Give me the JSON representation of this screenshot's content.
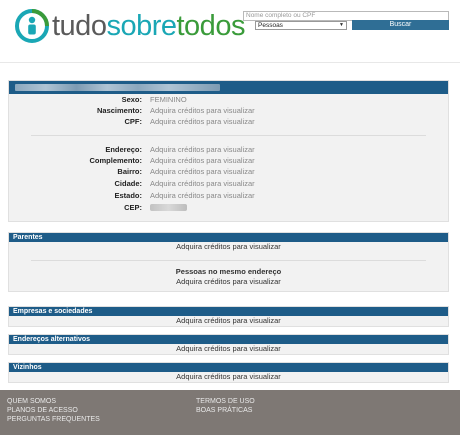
{
  "brand": {
    "name_parts": [
      "tudo",
      "sobre",
      "todos"
    ],
    "colors": {
      "gray": "#5a5a5a",
      "teal": "#1aa7b5",
      "green": "#3a9b3a",
      "header_blue": "#1e5c88",
      "button_blue": "#2f6e95"
    }
  },
  "search": {
    "placeholder": "Nome completo ou CPF",
    "select_value": "Pessoas",
    "button_label": "Buscar"
  },
  "person": {
    "fields_top": [
      {
        "label": "Sexo:",
        "value": "FEMININO"
      },
      {
        "label": "Nascimento:",
        "value": "Adquira créditos para visualizar"
      },
      {
        "label": "CPF:",
        "value": "Adquira créditos para visualizar"
      }
    ],
    "fields_address": [
      {
        "label": "Endereço:",
        "value": "Adquira créditos para visualizar"
      },
      {
        "label": "Complemento:",
        "value": "Adquira créditos para visualizar"
      },
      {
        "label": "Bairro:",
        "value": "Adquira créditos para visualizar"
      },
      {
        "label": "Cidade:",
        "value": "Adquira créditos para visualizar"
      },
      {
        "label": "Estado:",
        "value": "Adquira créditos para visualizar"
      }
    ],
    "cep_label": "CEP:"
  },
  "sections": {
    "parentes": {
      "title": "Parentes",
      "line1": "Adquira créditos para visualizar",
      "sub_title": "Pessoas no mesmo endereço",
      "line2": "Adquira créditos para visualizar"
    },
    "empresas": {
      "title": "Empresas e sociedades",
      "line": "Adquira créditos para visualizar"
    },
    "enderecos": {
      "title": "Endereços alternativos",
      "line": "Adquira créditos para visualizar"
    },
    "vizinhos": {
      "title": "Vizinhos",
      "line": "Adquira créditos para visualizar"
    }
  },
  "footer": {
    "links_left": [
      "QUEM SOMOS",
      "PLANOS DE ACESSO",
      "PERGUNTAS FREQUENTES"
    ],
    "links_right": [
      "TERMOS DE USO",
      "BOAS PRÁTICAS"
    ]
  }
}
